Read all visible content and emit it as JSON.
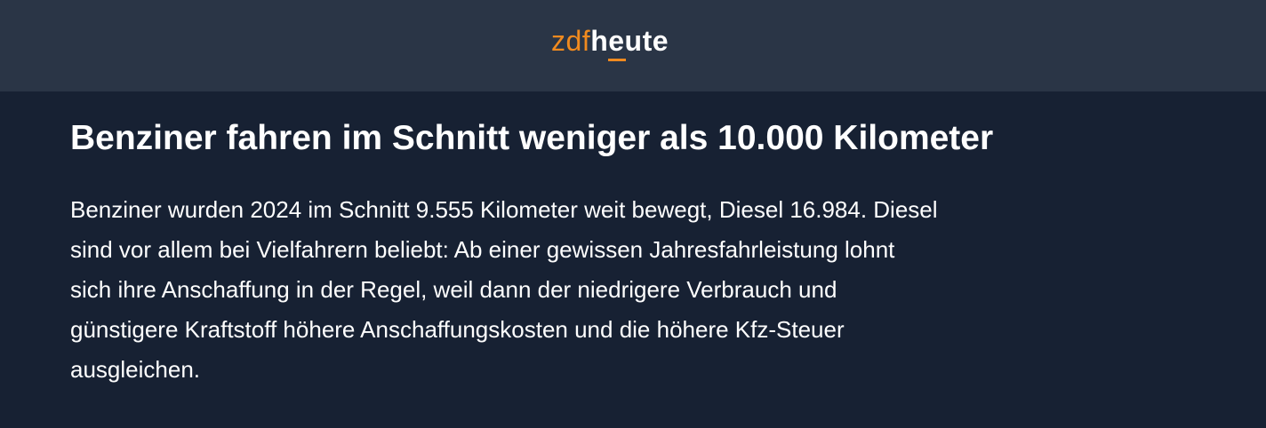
{
  "header": {
    "logo": {
      "part1": "zdf",
      "part2": "heute"
    }
  },
  "article": {
    "headline": "Benziner fahren im Schnitt weniger als 10.000 Kilometer",
    "paragraph_lines": [
      "Benziner wurden 2024 im Schnitt 9.555 Kilometer weit bewegt, Diesel 16.984. Diesel",
      "sind vor allem bei Vielfahrern beliebt: Ab einer gewissen Jahresfahrleistung lohnt",
      "sich ihre Anschaffung in der Regel, weil dann der niedrigere Verbrauch und",
      "günstigere Kraftstoff höhere Anschaffungskosten und die höhere Kfz-Steuer",
      "ausgleichen."
    ]
  },
  "colors": {
    "header_background": "#2a3546",
    "page_background": "#172133",
    "brand_orange": "#f08a1f",
    "text": "#ffffff"
  }
}
